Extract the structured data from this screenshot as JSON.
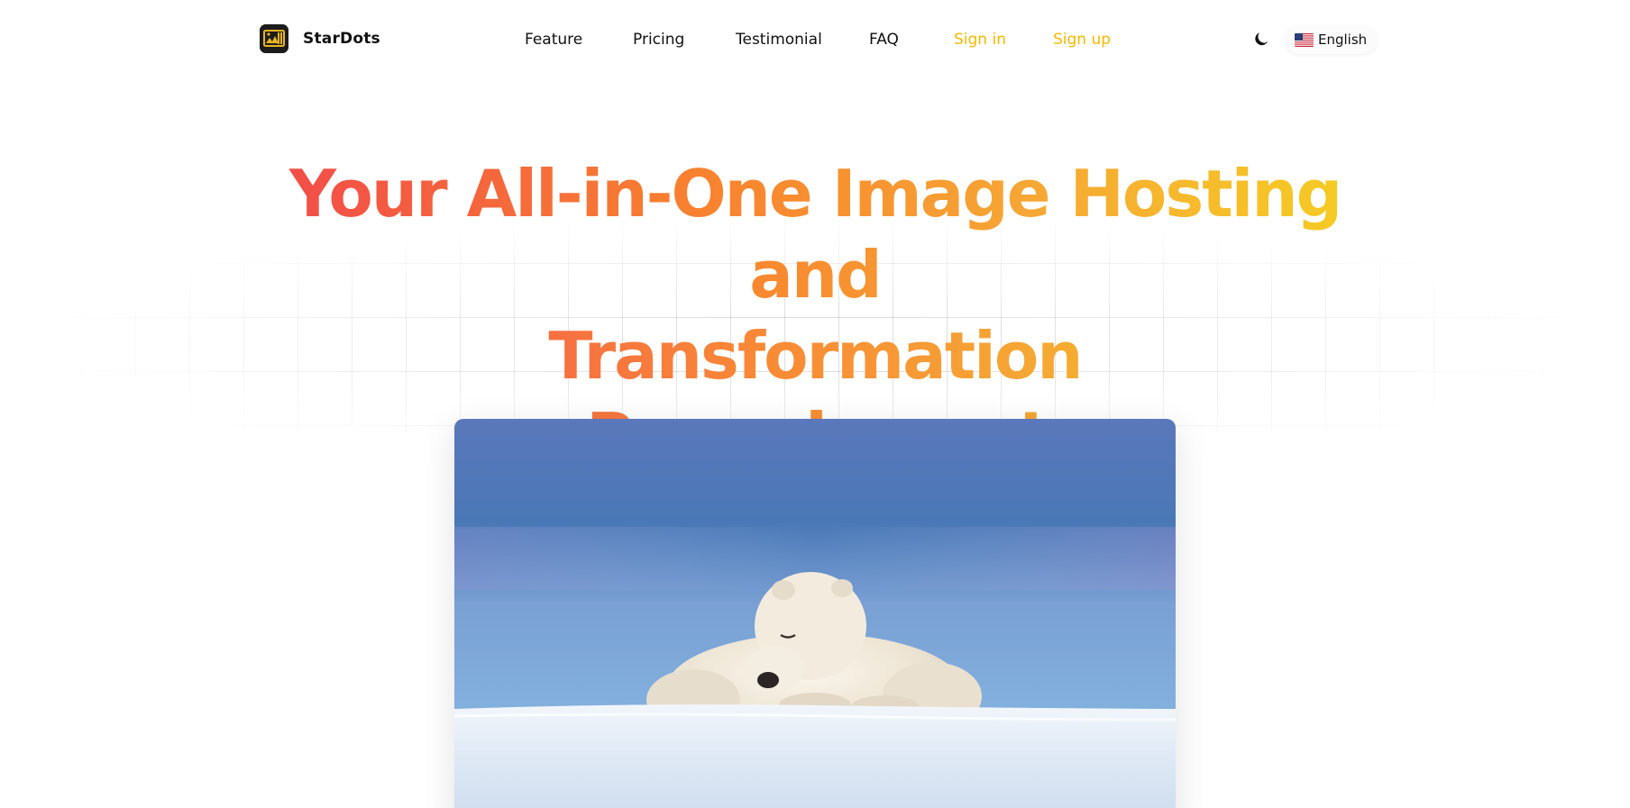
{
  "brand": {
    "name": "StarDots",
    "logo_icon": "stardots-logo-icon"
  },
  "nav": {
    "items": [
      {
        "label": "Feature"
      },
      {
        "label": "Pricing"
      },
      {
        "label": "Testimonial"
      },
      {
        "label": "FAQ"
      }
    ],
    "sign_in": "Sign in",
    "sign_up": "Sign up"
  },
  "controls": {
    "theme_icon": "moon-icon",
    "language": {
      "flag_icon": "us-flag-icon",
      "label": "English"
    }
  },
  "hero": {
    "title_line1": "Your All-in-One Image Hosting and",
    "title_line2": "Transformation Powerhouse!",
    "image_icon": "polar-bear-photo"
  },
  "colors": {
    "accent": "#f5b800",
    "gradient_start": "#f24a4a",
    "gradient_mid": "#f8822f",
    "gradient_end": "#f5cf22",
    "text": "#111111"
  }
}
